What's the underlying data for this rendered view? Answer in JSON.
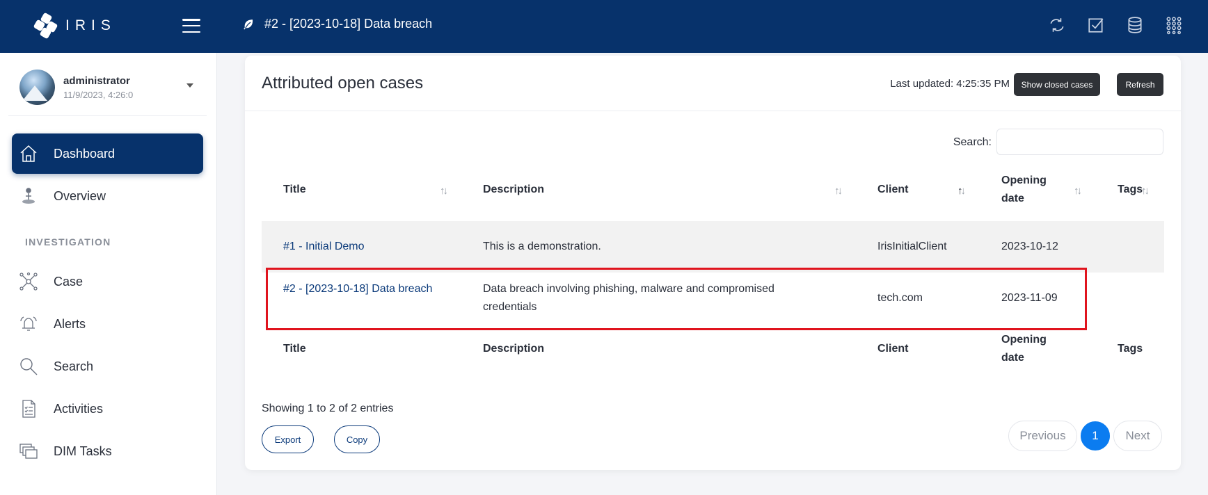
{
  "app": {
    "brand": "IRIS",
    "case_title": "#2 - [2023-10-18] Data breach"
  },
  "user": {
    "name": "administrator",
    "datetime": "11/9/2023, 4:26:0"
  },
  "sidebar": {
    "section": "INVESTIGATION",
    "items": [
      {
        "label": "Dashboard",
        "icon": "home-icon",
        "active": true
      },
      {
        "label": "Overview",
        "icon": "person-pin-icon"
      },
      {
        "label": "Case",
        "icon": "network-icon"
      },
      {
        "label": "Alerts",
        "icon": "alarm-icon"
      },
      {
        "label": "Search",
        "icon": "magnifier-icon"
      },
      {
        "label": "Activities",
        "icon": "checklist-icon"
      },
      {
        "label": "DIM Tasks",
        "icon": "stack-icon"
      }
    ]
  },
  "card": {
    "title": "Attributed open cases",
    "last_updated": "Last updated: 4:25:35 PM",
    "show_closed_label": "Show closed cases",
    "refresh_label": "Refresh",
    "search_label": "Search:",
    "search_value": ""
  },
  "table": {
    "columns": [
      "Title",
      "Description",
      "Client",
      "Opening date",
      "Tags"
    ],
    "footer_columns": [
      "Title",
      "Description",
      "Client",
      "Opening date",
      "Tags"
    ],
    "rows": [
      {
        "title": "#1 - Initial Demo",
        "description": "This is a demonstration.",
        "client": "IrisInitialClient",
        "opening_date": "2023-10-12",
        "tags": ""
      },
      {
        "title": "#2 - [2023-10-18] Data breach",
        "description": "Data breach involving phishing, malware and compromised credentials",
        "client": "tech.com",
        "opening_date": "2023-11-09",
        "tags": ""
      }
    ],
    "sorted_column": "Client",
    "sort_direction": "ascending"
  },
  "footer": {
    "showing": "Showing 1 to 2 of 2 entries",
    "export_label": "Export",
    "copy_label": "Copy",
    "previous_label": "Previous",
    "page": "1",
    "next_label": "Next"
  },
  "colors": {
    "topbar": "#07326b",
    "accent": "#0b7cf0",
    "highlight": "#e0141e",
    "dark_button": "#2f3237"
  }
}
